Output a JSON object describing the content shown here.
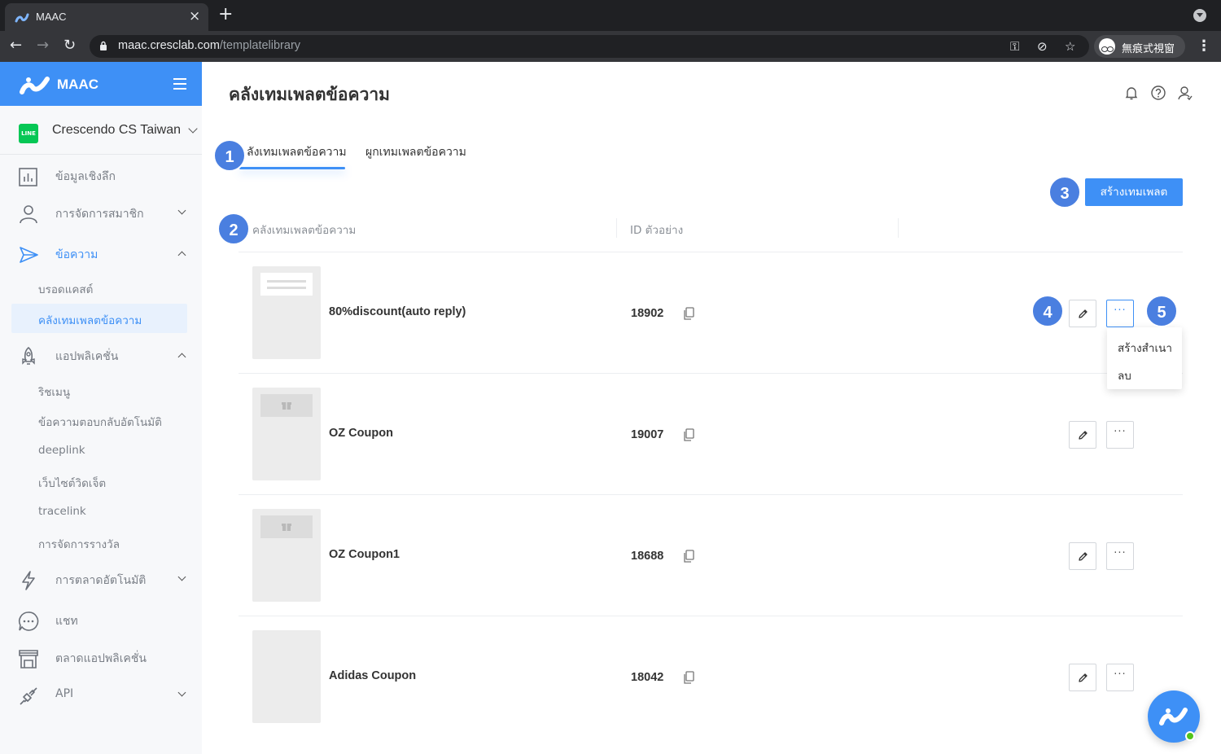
{
  "browser": {
    "tab_title": "MAAC",
    "url_host": "maac.cresclab.com",
    "url_path": "/templatelibrary",
    "profile_label": "無痕式視窗"
  },
  "sidebar": {
    "brand": "MAAC",
    "account_name": "Crescendo CS Taiwan",
    "line_badge": "LINE",
    "menu": {
      "insights": "ข้อมูลเชิงลึก",
      "members": "การจัดการสมาชิก",
      "messages": "ข้อความ",
      "apps": "แอปพลิเคชั่น",
      "automation": "การตลาดอัตโนมัติ",
      "chat": "แชท",
      "marketplace": "ตลาดแอปพลิเคชั่น",
      "api": "API"
    },
    "messages_sub": [
      "บรอดแคสต์",
      "คลังเทมเพลตข้อความ"
    ],
    "apps_sub": [
      "ริชเมนู",
      "ข้อความตอบกลับอัตโนมัติ",
      "deeplink",
      "เว็บไซต์วิดเจ็ต",
      "tracelink",
      "การจัดการรางวัล"
    ]
  },
  "main": {
    "title": "คลังเทมเพลตข้อความ",
    "tabs": [
      "ลังเทมเพลตข้อความ",
      "ผูกเทมเพลตข้อความ"
    ],
    "create_button": "สร้างเทมเพลต",
    "columns": [
      "คลังเทมเพลตข้อความ",
      "ID ตัวอย่าง"
    ],
    "templates": [
      {
        "name": "80%discount(auto reply)",
        "id": "18902",
        "thumb": "text"
      },
      {
        "name": "OZ Coupon",
        "id": "19007",
        "thumb": "gift"
      },
      {
        "name": "OZ Coupon1",
        "id": "18688",
        "thumb": "gift"
      },
      {
        "name": "Adidas Coupon",
        "id": "18042",
        "thumb": "blank"
      }
    ],
    "more_dots": "···",
    "dropdown": [
      "สร้างสำเนา",
      "ลบ"
    ]
  },
  "annotations": [
    "1",
    "2",
    "3",
    "4",
    "5"
  ],
  "colors": {
    "accent": "#3e90f6",
    "badge": "#4a7fe0",
    "line_green": "#06c755"
  }
}
